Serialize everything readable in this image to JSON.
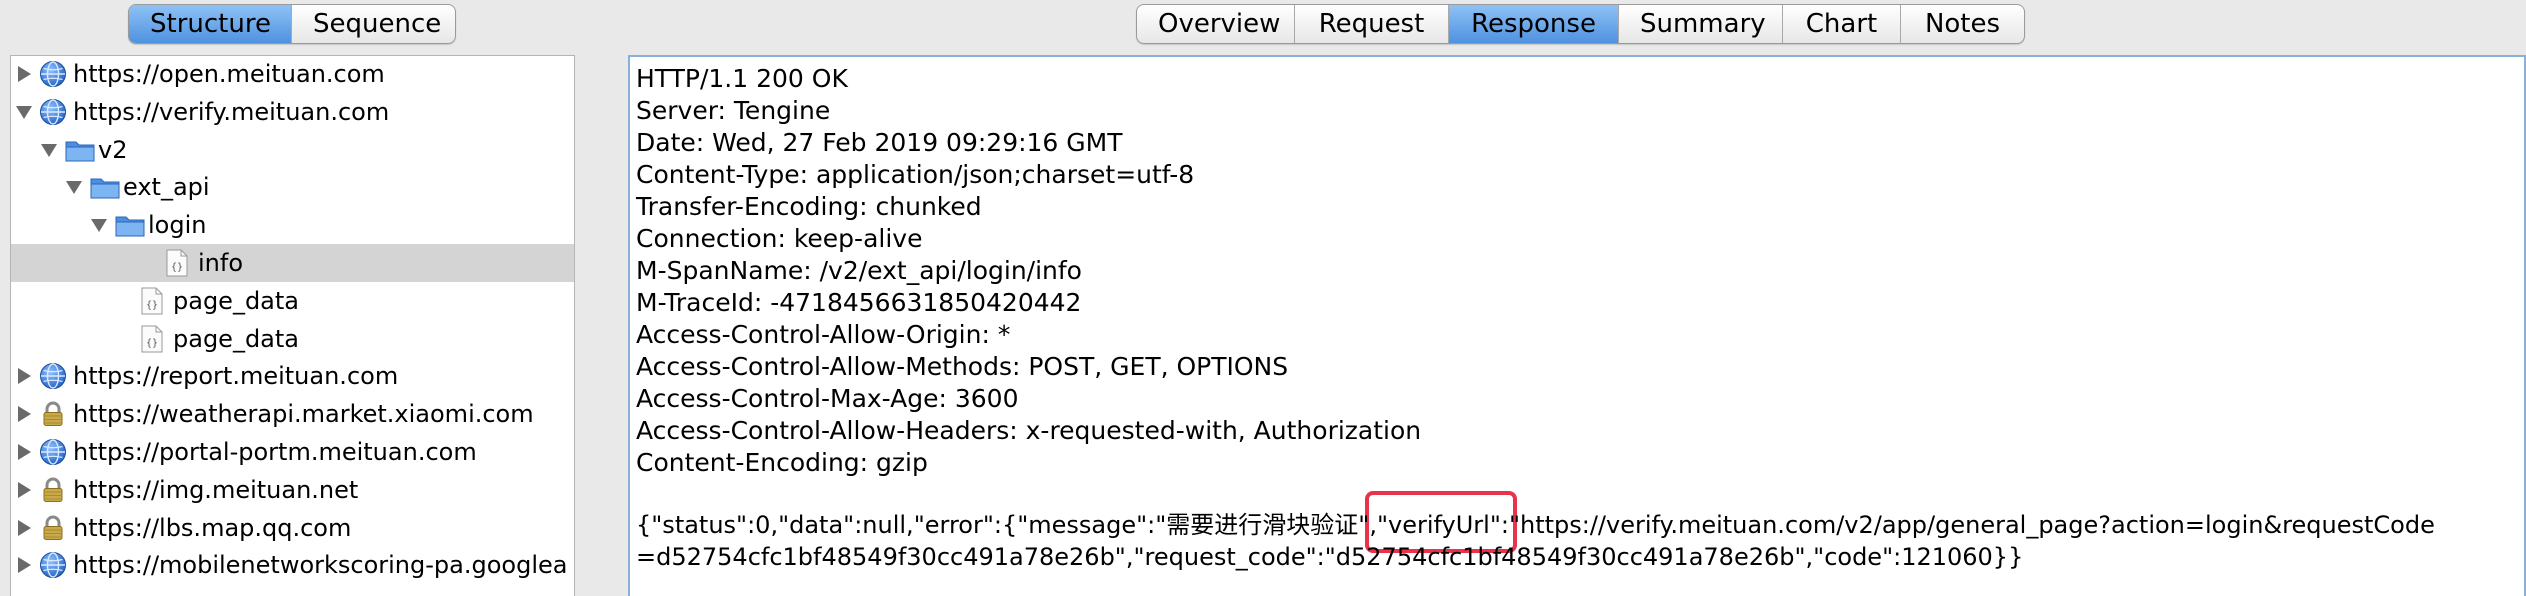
{
  "left_tabs": [
    "Structure",
    "Sequence"
  ],
  "left_tabs_selected": 0,
  "right_tabs": [
    "Overview",
    "Request",
    "Response",
    "Summary",
    "Chart",
    "Notes"
  ],
  "right_tabs_selected": 2,
  "tree": [
    {
      "label": "https://open.meituan.com",
      "icon": "globe-icon",
      "toggle": "collapsed",
      "depth": 0
    },
    {
      "label": "https://verify.meituan.com",
      "icon": "globe-icon",
      "toggle": "expanded",
      "depth": 0
    },
    {
      "label": "v2",
      "icon": "folder-icon",
      "toggle": "expanded",
      "depth": 1
    },
    {
      "label": "ext_api",
      "icon": "folder-icon",
      "toggle": "expanded",
      "depth": 2
    },
    {
      "label": "login",
      "icon": "folder-icon",
      "toggle": "expanded",
      "depth": 3
    },
    {
      "label": "info",
      "icon": "json-file-icon",
      "toggle": "none",
      "depth": 5,
      "selected": true
    },
    {
      "label": "page_data",
      "icon": "json-file-icon",
      "toggle": "none",
      "depth": 4
    },
    {
      "label": "page_data",
      "icon": "json-file-icon",
      "toggle": "none",
      "depth": 4
    },
    {
      "label": "https://report.meituan.com",
      "icon": "globe-icon",
      "toggle": "collapsed",
      "depth": 0
    },
    {
      "label": "https://weatherapi.market.xiaomi.com",
      "icon": "lock-icon",
      "toggle": "collapsed",
      "depth": 0
    },
    {
      "label": "https://portal-portm.meituan.com",
      "icon": "globe-icon",
      "toggle": "collapsed",
      "depth": 0
    },
    {
      "label": "https://img.meituan.net",
      "icon": "lock-icon",
      "toggle": "collapsed",
      "depth": 0
    },
    {
      "label": "https://lbs.map.qq.com",
      "icon": "lock-icon",
      "toggle": "collapsed",
      "depth": 0
    },
    {
      "label": "https://mobilenetworkscoring-pa.googlea",
      "icon": "globe-icon",
      "toggle": "collapsed",
      "depth": 0
    }
  ],
  "response_headers": [
    "HTTP/1.1 200 OK",
    "Server: Tengine",
    "Date: Wed, 27 Feb 2019 09:29:16 GMT",
    "Content-Type: application/json;charset=utf-8",
    "Transfer-Encoding: chunked",
    "Connection: keep-alive",
    "M-SpanName: /v2/ext_api/login/info",
    "M-TraceId: -4718456631850420442",
    "Access-Control-Allow-Origin: *",
    "Access-Control-Allow-Methods: POST, GET, OPTIONS",
    "Access-Control-Max-Age: 3600",
    "Access-Control-Allow-Headers: x-requested-with, Authorization",
    "Content-Encoding: gzip"
  ],
  "response_body": [
    "{\"status\":0,\"data\":null,\"error\":{\"message\":\"需要进行滑块验证\",\"verifyUrl\":\"https://verify.meituan.com/v2/app/general_page?action=login&requestCode",
    "=d52754cfc1bf48549f30cc491a78e26b\",\"request_code\":\"d52754cfc1bf48549f30cc491a78e26b\",\"code\":121060}}"
  ],
  "highlight_color": "#e8334a",
  "selected_tab_color": "#5b9ce6"
}
